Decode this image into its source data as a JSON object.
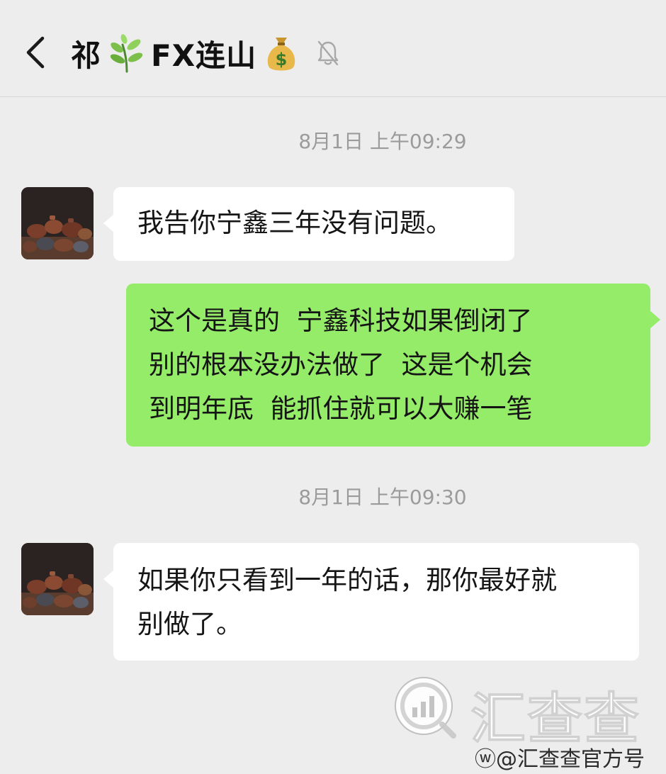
{
  "header": {
    "title_prefix": "祁",
    "title_main": "FX连山",
    "leaf_icon": "herb-leaf-icon",
    "money_icon": "money-bag-icon",
    "mute_icon": "bell-muted-icon",
    "back_icon": "chevron-left-icon"
  },
  "messages": [
    {
      "type": "timestamp",
      "text": "8月1日 上午09:29"
    },
    {
      "type": "incoming",
      "lines": [
        "我告你宁鑫三年没有问题。"
      ]
    },
    {
      "type": "outgoing",
      "lines": [
        "这个是真的  宁鑫科技如果倒闭了",
        "别的根本没办法做了  这是个机会",
        "到明年底  能抓住就可以大赚一笔"
      ]
    },
    {
      "type": "timestamp",
      "text": "8月1日 上午09:30"
    },
    {
      "type": "incoming",
      "lines": [
        "如果你只看到一年的话，那你最好就",
        "别做了。"
      ]
    }
  ],
  "watermark": {
    "brand": "汇查查",
    "caption": "@汇查查官方号"
  },
  "colors": {
    "background": "#ededed",
    "incoming_bubble": "#ffffff",
    "outgoing_bubble": "#95ec69",
    "timestamp_text": "#9b9b9b"
  }
}
